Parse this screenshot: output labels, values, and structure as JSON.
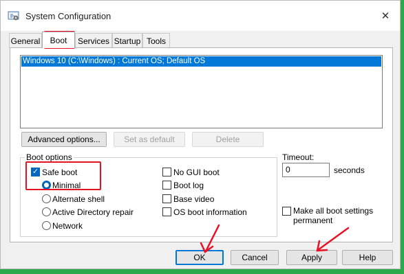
{
  "window": {
    "title": "System Configuration",
    "app_icon": "msconfig-icon",
    "close_glyph": "✕"
  },
  "tabs": [
    {
      "label": "General"
    },
    {
      "label": "Boot",
      "active": true
    },
    {
      "label": "Services"
    },
    {
      "label": "Startup"
    },
    {
      "label": "Tools"
    }
  ],
  "os_list": {
    "items": [
      "Windows 10 (C:\\Windows) : Current OS; Default OS"
    ],
    "selected_index": 0
  },
  "buttons": {
    "advanced": "Advanced options...",
    "set_default": "Set as default",
    "delete": "Delete"
  },
  "boot_options": {
    "title": "Boot options",
    "safe_boot": {
      "label": "Safe boot",
      "checked": true
    },
    "radios": [
      {
        "label": "Minimal",
        "selected": true
      },
      {
        "label": "Alternate shell",
        "selected": false
      },
      {
        "label": "Active Directory repair",
        "selected": false
      },
      {
        "label": "Network",
        "selected": false
      }
    ],
    "checks": [
      {
        "label": "No GUI boot",
        "checked": false
      },
      {
        "label": "Boot log",
        "checked": false
      },
      {
        "label": "Base video",
        "checked": false
      },
      {
        "label": "OS boot information",
        "checked": false
      }
    ]
  },
  "timeout": {
    "label": "Timeout:",
    "value": "0",
    "unit": "seconds"
  },
  "make_permanent": {
    "line1": "Make all boot settings",
    "line2": "permanent",
    "checked": false
  },
  "footer": {
    "ok": "OK",
    "cancel": "Cancel",
    "apply": "Apply",
    "help": "Help"
  },
  "colors": {
    "background": "#2aa84a",
    "highlight_annotation": "#e81123",
    "selection_blue": "#0078d7",
    "check_blue": "#0067c0"
  }
}
